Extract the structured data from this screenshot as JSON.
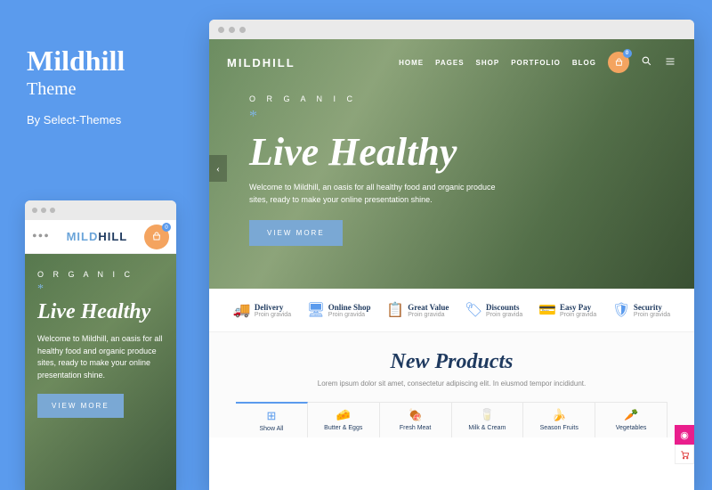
{
  "sidebar": {
    "title": "Mildhill",
    "subtitle": "Theme",
    "byline": "By Select-Themes"
  },
  "brand": {
    "logo_part1": "MILD",
    "logo_part2": "HILL",
    "logo_full": "MILDHILL",
    "cart_count": "0"
  },
  "nav": {
    "items": [
      "HOME",
      "PAGES",
      "SHOP",
      "PORTFOLIO",
      "BLOG"
    ]
  },
  "hero": {
    "tag": "O R G A N I C",
    "star": "*",
    "headline": "Live Healthy",
    "desc_desktop": "Welcome to Mildhill, an oasis for all healthy food and organic produce sites, ready to make your online presentation shine.",
    "desc_mobile": "Welcome to Mildhill, an oasis for all healthy food and organic produce sites, ready to make your online presentation shine.",
    "button": "VIEW MORE"
  },
  "features": [
    {
      "icon": "🚚",
      "title": "Delivery",
      "sub": "Proin gravida"
    },
    {
      "icon": "🖥",
      "title": "Online Shop",
      "sub": "Proin gravida"
    },
    {
      "icon": "📋",
      "title": "Great Value",
      "sub": "Proin gravida"
    },
    {
      "icon": "🏷",
      "title": "Discounts",
      "sub": "Proin gravida"
    },
    {
      "icon": "💳",
      "title": "Easy Pay",
      "sub": "Proin gravida"
    },
    {
      "icon": "🛡",
      "title": "Security",
      "sub": "Proin gravida"
    }
  ],
  "new_products": {
    "title": "New Products",
    "sub": "Lorem ipsum dolor sit amet, consectetur adipiscing elit. In eiusmod tempor incididunt."
  },
  "categories": [
    {
      "icon": "⊞",
      "label": "Show All"
    },
    {
      "icon": "🧀",
      "label": "Butter & Eggs"
    },
    {
      "icon": "🍖",
      "label": "Fresh Meat"
    },
    {
      "icon": "🥛",
      "label": "Milk & Cream"
    },
    {
      "icon": "🍌",
      "label": "Season Fruits"
    },
    {
      "icon": "🥕",
      "label": "Vegetables"
    }
  ]
}
